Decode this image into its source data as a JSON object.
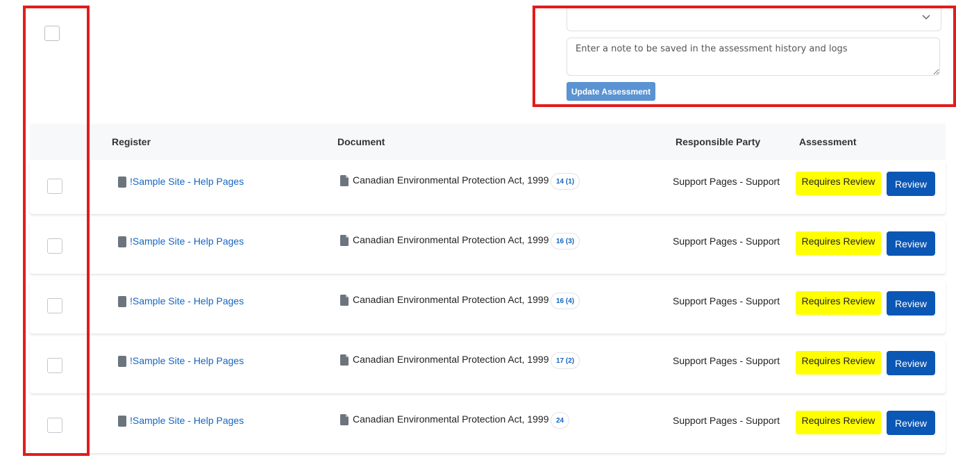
{
  "assessment_panel": {
    "note_placeholder": "Enter a note to be saved in the assessment history and logs",
    "update_button_label": "Update Assessment",
    "select_value": ""
  },
  "table": {
    "headers": {
      "register": "Register",
      "document": "Document",
      "responsible_party": "Responsible Party",
      "assessment": "Assessment"
    },
    "rows": [
      {
        "register": "!Sample Site - Help Pages",
        "document": "Canadian Environmental Protection Act, 1999",
        "badge": "14 (1)",
        "responsible_party": "Support Pages - Support",
        "status": "Requires Review",
        "action": "Review"
      },
      {
        "register": "!Sample Site - Help Pages",
        "document": "Canadian Environmental Protection Act, 1999",
        "badge": "16 (3)",
        "responsible_party": "Support Pages - Support",
        "status": "Requires Review",
        "action": "Review"
      },
      {
        "register": "!Sample Site - Help Pages",
        "document": "Canadian Environmental Protection Act, 1999",
        "badge": "16 (4)",
        "responsible_party": "Support Pages - Support",
        "status": "Requires Review",
        "action": "Review"
      },
      {
        "register": "!Sample Site - Help Pages",
        "document": "Canadian Environmental Protection Act, 1999",
        "badge": "17 (2)",
        "responsible_party": "Support Pages - Support",
        "status": "Requires Review",
        "action": "Review"
      },
      {
        "register": "!Sample Site - Help Pages",
        "document": "Canadian Environmental Protection Act, 1999",
        "badge": "24",
        "responsible_party": "Support Pages - Support",
        "status": "Requires Review",
        "action": "Review"
      }
    ]
  },
  "icons": {
    "register": "register-doc-icon",
    "document": "document-file-icon",
    "select": "chevron-down-icon"
  },
  "colors": {
    "status_bg": "#ffff00",
    "review_button": "#0b57b5",
    "update_button": "#5b93d3",
    "link": "#1565c0",
    "highlight": "#e21c1c"
  }
}
